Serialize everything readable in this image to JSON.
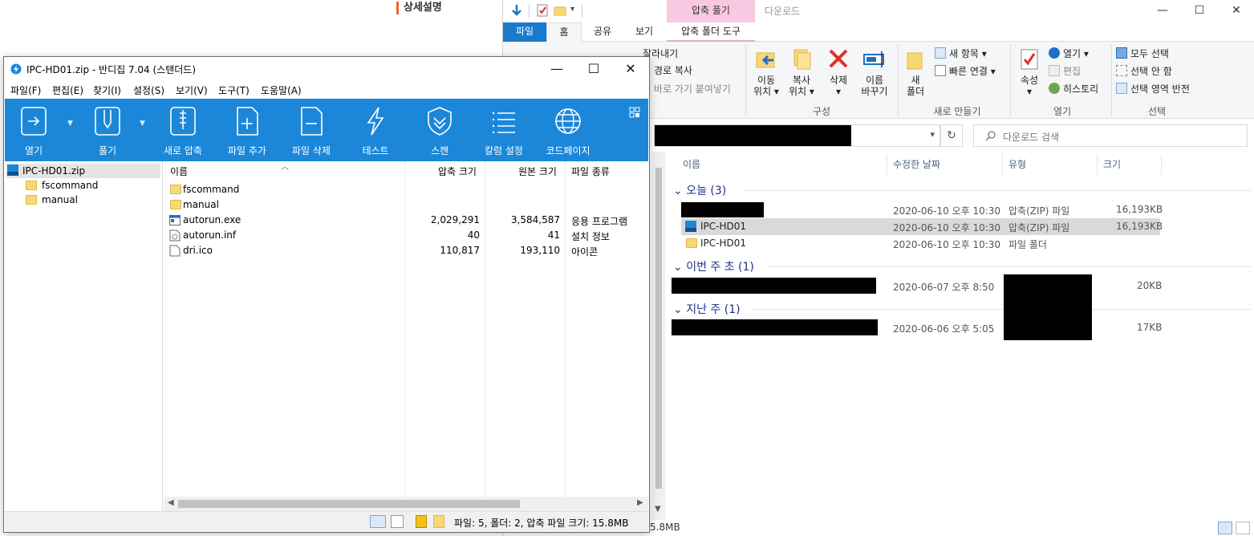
{
  "background_page": {
    "heading": "상세설명"
  },
  "explorer": {
    "title": "다운로드",
    "context_tab_header": "압축 풀기",
    "tabs": [
      "파일",
      "홈",
      "공유",
      "보기",
      "압축 폴더 도구"
    ],
    "ribbon": {
      "clipboard": {
        "cut": "잘라내기",
        "copy_path": "경로 복사",
        "paste_shortcut": "바로 가기 붙여넣기"
      },
      "organize": {
        "move_to": [
          "이동",
          "위치 ▾"
        ],
        "copy_to": [
          "복사",
          "위치 ▾"
        ],
        "delete": [
          "삭제",
          "▾"
        ],
        "rename": [
          "이름",
          "바꾸기"
        ],
        "group": "구성"
      },
      "new": {
        "new_folder": [
          "새",
          "폴더"
        ],
        "new_item": "새 항목 ▾",
        "easy_access": "빠른 연결 ▾",
        "group": "새로 만들기"
      },
      "open": {
        "properties": [
          "속성",
          "▾"
        ],
        "open": "열기 ▾",
        "edit": "편집",
        "history": "히스토리",
        "group": "열기"
      },
      "select": {
        "select_all": "모두 선택",
        "select_none": "선택 안 함",
        "invert": "선택 영역 반전",
        "group": "선택"
      }
    },
    "search_placeholder": "다운로드 검색",
    "columns": [
      "이름",
      "수정한 날짜",
      "유형",
      "크기"
    ],
    "groups": [
      {
        "label": "오늘 (3)",
        "rows": [
          {
            "name": "",
            "date": "2020-06-10 오후 10:30",
            "type": "압축(ZIP) 파일",
            "size": "16,193KB",
            "redacted_name": true
          },
          {
            "name": "IPC-HD01",
            "date": "2020-06-10 오후 10:30",
            "type": "압축(ZIP) 파일",
            "size": "16,193KB",
            "selected": true,
            "icon": "zip-icon"
          },
          {
            "name": "IPC-HD01",
            "date": "2020-06-10 오후 10:30",
            "type": "파일 폴더",
            "size": "",
            "icon": "folder-icon"
          }
        ]
      },
      {
        "label": "이번 주 초 (1)",
        "rows": [
          {
            "name": "",
            "date": "2020-06-07 오후 8:50",
            "type": "",
            "size": "20KB",
            "redacted_name": true
          }
        ]
      },
      {
        "label": "지난 주 (1)",
        "rows": [
          {
            "name": "",
            "date": "2020-06-06 오후 5:05",
            "type": "",
            "size": "17KB",
            "redacted_name": true
          }
        ]
      }
    ],
    "status_size": "5.8MB"
  },
  "bandizip": {
    "title": "IPC-HD01.zip - 반디집 7.04 (스탠더드)",
    "menu": [
      "파일(F)",
      "편집(E)",
      "찾기(I)",
      "설정(S)",
      "보기(V)",
      "도구(T)",
      "도움말(A)"
    ],
    "toolbar": [
      "열기",
      "풀기",
      "새로 압축",
      "파일 추가",
      "파일 삭제",
      "테스트",
      "스캔",
      "칼럼 설정",
      "코드페이지"
    ],
    "tree": {
      "root": "IPC-HD01.zip",
      "children": [
        "fscommand",
        "manual"
      ]
    },
    "columns": [
      "이름",
      "압축 크기",
      "원본 크기",
      "파일 종류"
    ],
    "files": [
      {
        "name": "fscommand",
        "packed": "",
        "original": "",
        "kind": "",
        "icon": "folder-icon"
      },
      {
        "name": "manual",
        "packed": "",
        "original": "",
        "kind": "",
        "icon": "folder-icon"
      },
      {
        "name": "autorun.exe",
        "packed": "2,029,291",
        "original": "3,584,587",
        "kind": "응용 프로그램",
        "icon": "exe-icon"
      },
      {
        "name": "autorun.inf",
        "packed": "40",
        "original": "41",
        "kind": "설치 정보",
        "icon": "inf-icon"
      },
      {
        "name": "dri.ico",
        "packed": "110,817",
        "original": "193,110",
        "kind": "아이콘",
        "icon": "file-icon"
      }
    ],
    "status": "파일: 5, 폴더: 2, 압축 파일 크기: 15.8MB"
  },
  "colors": {
    "bandizip_toolbar": "#1c87d8",
    "explorer_file_tab": "#1979ca",
    "context_tab": "#f8c9e0"
  }
}
